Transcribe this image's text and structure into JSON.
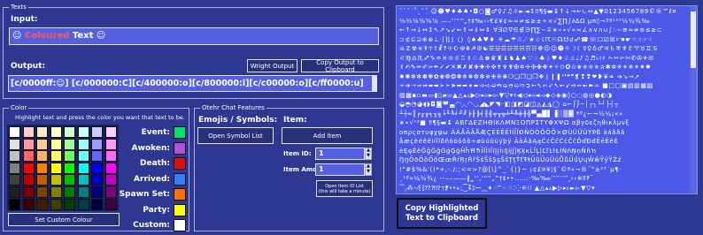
{
  "texts": {
    "legend": "Texts",
    "input_label": "Input:",
    "input_text": [
      "☺ ",
      "Coloured",
      " Text ",
      "☺"
    ],
    "input_colors": [
      "#ffffff",
      "#ff5a5a",
      "#ffffff",
      "#ffffff"
    ],
    "output_label": "Output:",
    "wright_output": "Wright Output",
    "copy_output": "Copy Output to Clipboard",
    "output_value": "[c/0000ff:☺] [c/000000:C][c/400000:o][c/800000:l][c/c00000:o][c/ff0000:u]"
  },
  "color": {
    "legend": "Color",
    "hint": "Highlight text and press the color you want that text to be.",
    "set_custom": "Set Custom Colour",
    "palette": [
      [
        "#ffffff",
        "#ffcccc",
        "#ffe5cc",
        "#ffffcc",
        "#ccffcc",
        "#ccffff",
        "#ccccff",
        "#ffccff"
      ],
      [
        "#e0e0e0",
        "#ff9999",
        "#ffcc99",
        "#ffff99",
        "#99ff99",
        "#99ffff",
        "#9999ff",
        "#ff99ff"
      ],
      [
        "#c0c0c0",
        "#ff6666",
        "#ffb266",
        "#ffff66",
        "#66ff66",
        "#66ffff",
        "#6666ff",
        "#ff66ff"
      ],
      [
        "#808080",
        "#ff0000",
        "#ff8000",
        "#ffff00",
        "#00ff00",
        "#00ffff",
        "#0000ff",
        "#ff00ff"
      ],
      [
        "#404040",
        "#c00000",
        "#c06000",
        "#c0c000",
        "#00c000",
        "#00c0c0",
        "#0000c0",
        "#c000c0"
      ],
      [
        "#202020",
        "#800000",
        "#804000",
        "#808000",
        "#008000",
        "#008080",
        "#000080",
        "#800080"
      ],
      [
        "#000000",
        "#400000",
        "#402000",
        "#404000",
        "#004000",
        "#004040",
        "#000040",
        "#400040"
      ]
    ],
    "presets": [
      {
        "label": "Event:",
        "color": "#00e070"
      },
      {
        "label": "Awoken:",
        "color": "#b050e0"
      },
      {
        "label": "Death:",
        "color": "#e01010"
      },
      {
        "label": "Arrived:",
        "color": "#3080ff"
      },
      {
        "label": "Spawn Set:",
        "color": "#ff7000"
      },
      {
        "label": "Party:",
        "color": "#ffff00"
      },
      {
        "label": "Custom:",
        "color": "#ffffff"
      }
    ]
  },
  "chat": {
    "legend": "Otehr Chat Features",
    "emoji_heading": "Emojis / Symbols:",
    "item_heading": "Item:",
    "open_symbol_list": "Open Symbol List",
    "add_item": "Add Item",
    "item_id_label": "Item ID:",
    "item_id_value": "1",
    "item_amount_label": "Item Amount:",
    "item_amount_value": "1",
    "open_item_id_list": "Open Item ID List",
    "open_item_id_note": "(this will take a minute)"
  },
  "symbols": {
    "rows": [
      "ˇˇ˘˙˚˛˜˝ ☺☻♥♦♣♠•◘○◙♂♀♪♫☼►◄↕‼¶§▬↨↑↓→←∟↔▲▼0123456789©®™ℓ¤",
      "⅓⅔⅛⅜⅝⅞ —–‘’“”„†‡‰‹›€£¥¢∞≈≠≤≥±÷×√∑∏∫∂∆Ω µπ◊¬ºª¹²³½¼¾‰",
      "←↑→↓↔↕↖↗↘↙⇐⇑⇒⇓⇔⇕ ∀∃∅∇∈∉∋∏∑−∓∗∘∙√∝∞∠∧∨∩∪∫∴∼≅≈≠≡≤≥⊂",
      "⊃⊄⊆⊇⊕⊗⊥⋅⌈⌉⌊⌋〈〉◊♠♣♥♦ ☀☁☂☃☄★☆☇☈☉☊☋☌☍☎☏☐☑☒☓☚☛☜☝☞☟",
      "☠☡☢☣☤☥☦☧☨☩☪☫☬☭☮☯☰☱☲☳☴☵☶☷☸☹☺☻☼☽☾☿♀♁♂♃♄♅♆♇♈♉♊♋",
      "♌♍♎♏♐♑♒♓♔♕♖♗♘♙♚♛♜♝♞♟♠♡♢♣♤♥♦♧♨♩♪♫♬♭♮♯ ✁✂✃✄✆✇✈✉",
      "✌✍✎✏✐✑✒✓✔✕✖✗✘✙✚✛✜✝✞✟✠✡✢✣✤✥✦✧✩✪✫✬✭✮✯✰✱✲✳✴✵✶✷✸",
      "✹✺✻✼✽✾✿❀❁❂❃❄❅❆❇❈❉❊❋❍❏❐❑❒❖❘❙❚❛❜❝❞❡❢❣❤❥❦❧ ➔➘➙➚",
      "➛➜➝➞➟➠➡➢➣➤➥➦➧➨➩➪➫➬➭➮➯➱➲➳➴➵➶➷➸➹➺➻➼➽➾ ■□▢▣▤▥▦▧",
      "▨▩▪▫▬▭▮▯▰▱▲△▴▵▶▷▸▹►▻▼▽▾▿◀◁◂◃◄◅◆◇◈◉◊○◌◍◎●◐◑",
      "◒◓◔◕◖◗◘◙◚◛◜◝◞◟◠◡◢◣◤◥◦◧◨◩◪◫◬◭◮◯ ⌂⌐⌠⌡─│┌┐└┘├┤┬",
      "┴┼═║╒╓╔╕╖╗╘╙╚╛╜╝╞╟╠╡╢╣╤╥╦╧╨╩╪╫╬▀▄█▌▐░▒▓ ªº¿⌐¬½¼¡«»",
      "∗∙√ⁿ²■ ‼¶§▬↨ ΑΒΓΔΕΖΗΘΙΚΛΜΝΞΟΠΡΣΤΥΦΧΨΩ αβγδεζηθικλμνξ",
      "οπρςστυφχψω ÀÁÂÃÄÅÆÇÈÉÊËÌÍÎÏÐÑÒÓÔÕÖ×ØÙÚÛÜÝÞß àáâãä",
      "åæçèéêëìíîïðñòóôõö÷øùúûüýþÿ ĀāĂăĄąĆćĈĉĊċČčĎďĐđĒēĔĕĖ",
      "ėĘęĚěĜĝĞğĠġĢģĤĥĦħĨĩĪīĬĭĮįİıĲĳĴĵĶķĸĹĺĻļĽľĿŀŁłŃńŅņŇňŉ",
      "ŊŋŌōŎŏŐőŒœŔŕŖŗŘřŚśŜŝŞşŠšŢţŤťŦŧŨũŪūŬŭŮůŰűŲųŴŵŶŷŸŹź",
      "!\"#$%&'()*+,-./:;<=>?@[\\]^_`{|}~ ¡¢£¤¥¦§¨©ª«¬®¯°±²³´µ¶·",
      "¸¹º»¼½¾¿ ‐‑‒–—―‖‗‘’‚‛“”„‟†‡•‣․‥…‧‰‱′″‴‵‶‷‸‹›※‼‽‾",
      "⁀⁁⁂⁃⁄⁅⁆⁇⁈⁉⁊⁋⁌⁍⁎⁏⁐⁑⁒⁓⁔⁕⁖⁗⁘⁙⁚⁛⁜⁝⁞ ▲△▴▵▶▷▸▹►▻▼▽▾"
    ],
    "copy_button": "Copy Highlighted Text to Clipboard"
  }
}
